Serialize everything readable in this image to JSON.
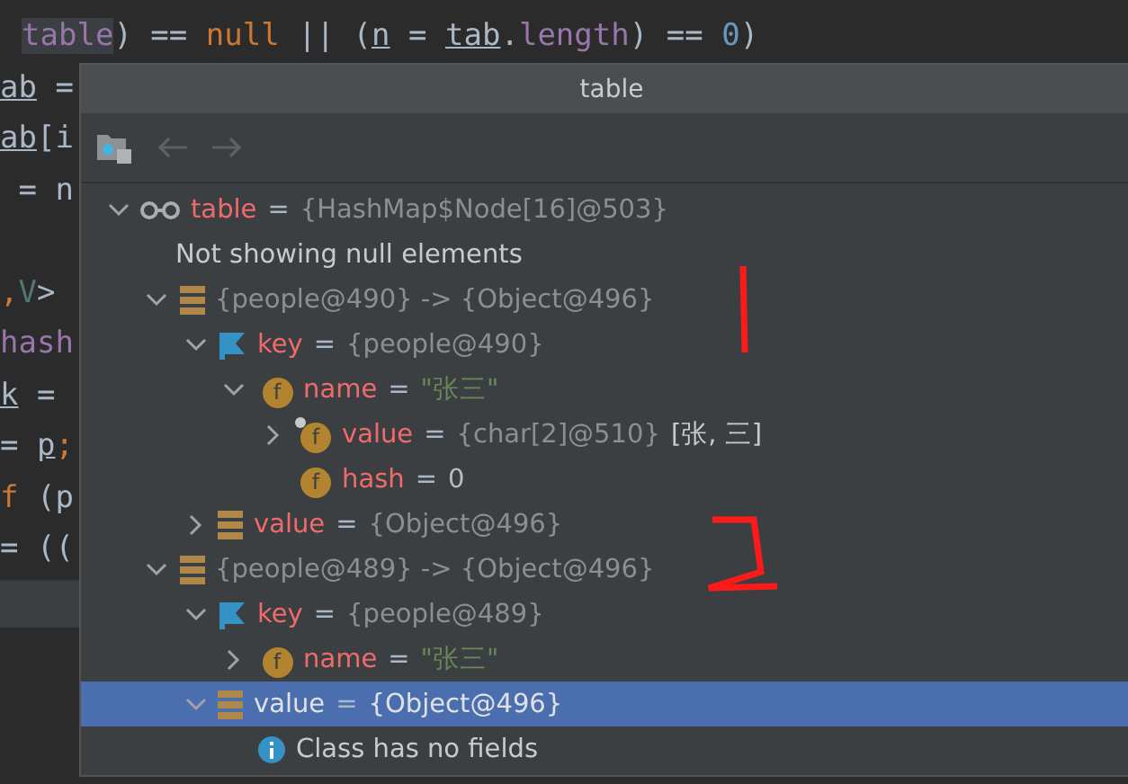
{
  "editor": {
    "lines": [
      {
        "tokens": [
          {
            "text": "table",
            "kind": "field",
            "highlighted": true
          },
          {
            "text": ") == ",
            "kind": "plain"
          },
          {
            "text": "null",
            "kind": "keyword"
          },
          {
            "text": " || (",
            "kind": "plain"
          },
          {
            "text": "n",
            "kind": "plain",
            "underlined": true
          },
          {
            "text": " = ",
            "kind": "plain"
          },
          {
            "text": "tab",
            "kind": "plain",
            "underlined": true
          },
          {
            "text": ".",
            "kind": "plain"
          },
          {
            "text": "length",
            "kind": "field"
          },
          {
            "text": ") == ",
            "kind": "plain"
          },
          {
            "text": "0",
            "kind": "number"
          },
          {
            "text": ")",
            "kind": "plain"
          }
        ]
      },
      {
        "tokens": [
          {
            "text": "ab",
            "kind": "plain",
            "underlined": true
          },
          {
            "text": " =",
            "kind": "plain"
          }
        ]
      },
      {
        "tokens": [
          {
            "text": "ab",
            "kind": "plain",
            "underlined": true
          },
          {
            "text": "[i",
            "kind": "plain"
          }
        ]
      },
      {
        "tokens": [
          {
            "text": " = n",
            "kind": "plain"
          }
        ]
      },
      {
        "gap_before": true,
        "tokens": [
          {
            "text": ",",
            "kind": "keyword"
          },
          {
            "text": "V",
            "kind": "type"
          },
          {
            "text": ">",
            "kind": "plain"
          }
        ]
      },
      {
        "tokens": [
          {
            "text": "hash",
            "kind": "field"
          }
        ]
      },
      {
        "tokens": [
          {
            "text": "k",
            "kind": "plain",
            "underlined": true
          },
          {
            "text": " =",
            "kind": "plain"
          }
        ]
      },
      {
        "tokens": [
          {
            "text": "= ",
            "kind": "plain"
          },
          {
            "text": "p",
            "kind": "plain",
            "underlined": true
          },
          {
            "text": ";",
            "kind": "keyword"
          }
        ]
      },
      {
        "tokens": [
          {
            "text": "f",
            "kind": "keyword"
          },
          {
            "text": " (p",
            "kind": "plain"
          }
        ]
      },
      {
        "tokens": [
          {
            "text": "= ((",
            "kind": "plain"
          }
        ]
      }
    ]
  },
  "popup": {
    "title": "table",
    "tree": [
      {
        "kind": "watch",
        "expanded": true,
        "selected": false,
        "name": "table",
        "sep": "=",
        "value": "{HashMap$Node[16]@503}",
        "children": [
          {
            "kind": "note",
            "text": "Not showing null elements"
          },
          {
            "kind": "entry",
            "expanded": true,
            "selected": false,
            "value": "{people@490}  -> {Object@496}",
            "children": [
              {
                "kind": "key",
                "expanded": true,
                "selected": false,
                "name": "key",
                "sep": "=",
                "value": "{people@490}",
                "children": [
                  {
                    "kind": "field",
                    "badge": "f",
                    "expanded": true,
                    "selected": false,
                    "name": "name",
                    "sep": "=",
                    "value": "\"张三\"",
                    "color": "#6a8759",
                    "children": [
                      {
                        "kind": "field",
                        "badge": "f",
                        "pinned": true,
                        "expanded": false,
                        "selected": false,
                        "name": "value",
                        "sep": "=",
                        "value": "{char[2]@510}",
                        "extra": "[张, 三]"
                      },
                      {
                        "kind": "field",
                        "badge": "f",
                        "selected": false,
                        "name": "hash",
                        "sep": "=",
                        "value": "0",
                        "color": "#bbbbbb"
                      }
                    ]
                  }
                ]
              },
              {
                "kind": "entry",
                "expanded": false,
                "selected": false,
                "name": "value",
                "sep": "=",
                "value": "{Object@496}"
              }
            ]
          },
          {
            "kind": "entry",
            "expanded": true,
            "selected": false,
            "value": "{people@489}  -> {Object@496}",
            "children": [
              {
                "kind": "key",
                "expanded": true,
                "selected": false,
                "name": "key",
                "sep": "=",
                "value": "{people@489}",
                "children": [
                  {
                    "kind": "field",
                    "badge": "f",
                    "expanded": false,
                    "selected": false,
                    "name": "name",
                    "sep": "=",
                    "value": "\"张三\"",
                    "color": "#6a8759"
                  }
                ]
              },
              {
                "kind": "entry",
                "expanded": true,
                "selected": true,
                "name": "value",
                "sep": "=",
                "value": "{Object@496}",
                "children": [
                  {
                    "kind": "info",
                    "text": "Class has no fields"
                  }
                ]
              }
            ]
          }
        ]
      }
    ]
  }
}
